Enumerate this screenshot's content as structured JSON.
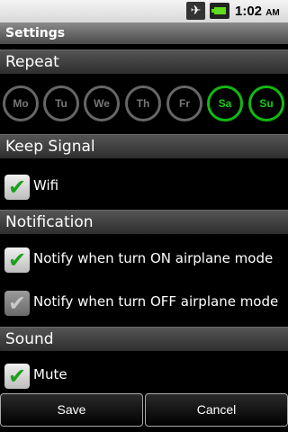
{
  "status_bar": {
    "time": "1:02",
    "ampm": "AM",
    "icons": [
      "airplane-mode-icon",
      "battery-icon"
    ]
  },
  "title": "Settings",
  "sections": {
    "repeat": "Repeat",
    "keep_signal": "Keep Signal",
    "notification": "Notification",
    "sound": "Sound"
  },
  "days": [
    {
      "label": "Mo",
      "selected": false
    },
    {
      "label": "Tu",
      "selected": false
    },
    {
      "label": "We",
      "selected": false
    },
    {
      "label": "Th",
      "selected": false
    },
    {
      "label": "Fr",
      "selected": false
    },
    {
      "label": "Sa",
      "selected": true
    },
    {
      "label": "Su",
      "selected": true
    }
  ],
  "options": {
    "wifi": {
      "label": "Wifi",
      "checked": true
    },
    "notify_on": {
      "label": "Notify when turn ON airplane mode",
      "checked": true
    },
    "notify_off": {
      "label": "Notify when turn OFF airplane mode",
      "checked": false
    },
    "mute": {
      "label": "Mute",
      "checked": true
    }
  },
  "buttons": {
    "save": "Save",
    "cancel": "Cancel"
  },
  "colors": {
    "day_selected": "#12b812",
    "check_green": "#1da01d"
  }
}
